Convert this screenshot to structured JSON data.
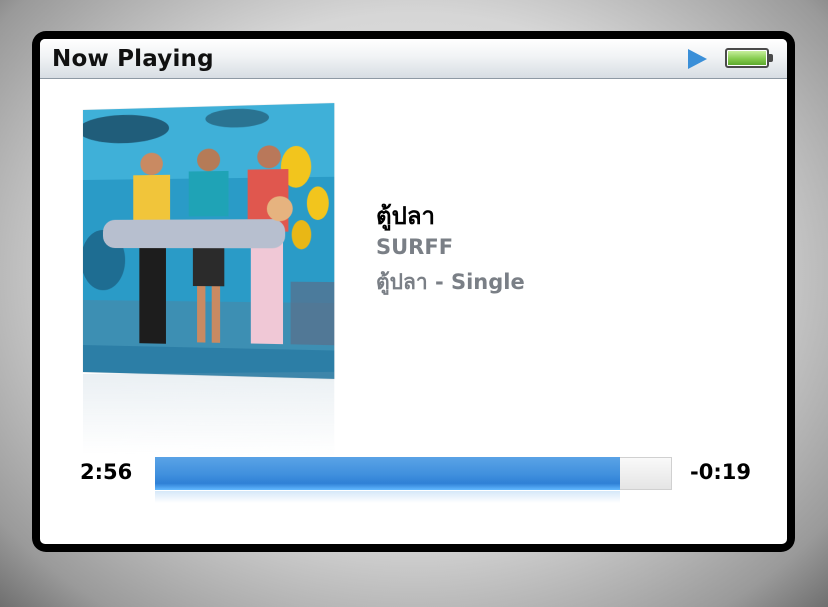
{
  "header": {
    "title": "Now Playing",
    "play_icon": "play-icon",
    "battery_icon": "battery-icon",
    "battery_level": 1.0,
    "accent_color": "#3a8fd8"
  },
  "track": {
    "title": "ตู้ปลา",
    "artist": "SURFF",
    "album": "ตู้ปลา - Single"
  },
  "playback": {
    "elapsed": "2:56",
    "remaining": "-0:19",
    "progress": 0.9
  }
}
